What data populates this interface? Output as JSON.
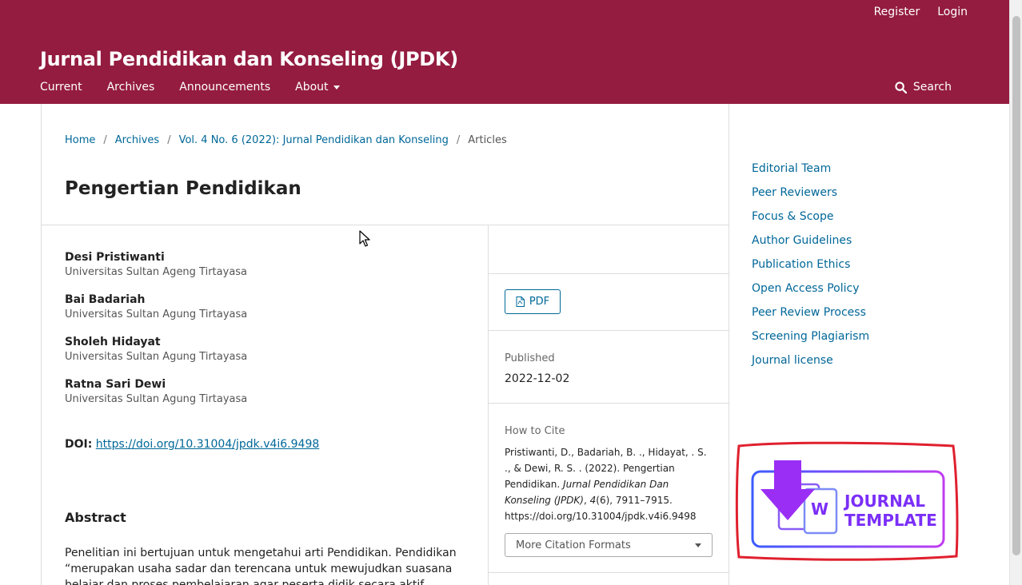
{
  "header": {
    "user_nav": {
      "register": "Register",
      "login": "Login"
    },
    "site_title": "Jurnal Pendidikan dan Konseling (JPDK)",
    "nav": {
      "current": "Current",
      "archives": "Archives",
      "announcements": "Announcements",
      "about": "About"
    },
    "search_label": "Search"
  },
  "breadcrumb": {
    "home": "Home",
    "archives": "Archives",
    "issue": "Vol. 4 No. 6 (2022): Jurnal Pendidikan dan Konseling",
    "current": "Articles",
    "separator": "/"
  },
  "article": {
    "title": "Pengertian Pendidikan",
    "authors": [
      {
        "name": "Desi Pristiwanti",
        "affiliation": "Universitas Sultan Ageng Tirtayasa"
      },
      {
        "name": "Bai Badariah",
        "affiliation": "Universitas Sultan Agung Tirtayasa"
      },
      {
        "name": "Sholeh Hidayat",
        "affiliation": "Universitas Sultan Agung Tirtayasa"
      },
      {
        "name": "Ratna Sari Dewi",
        "affiliation": "Universitas Sultan Agung Tirtayasa"
      }
    ],
    "doi_label": "DOI:",
    "doi_link": "https://doi.org/10.31004/jpdk.v4i6.9498",
    "abstract_heading": "Abstract",
    "abstract_text": "Penelitian ini bertujuan untuk mengetahui arti Pendidikan. Pendidikan “merupakan usaha sadar dan terencana untuk mewujudkan suasana belajar dan proses pembelajaran agar peserta didik secara aktif"
  },
  "details": {
    "pdf_label": "PDF",
    "published_label": "Published",
    "published_date": "2022-12-02",
    "how_to_cite_label": "How to Cite",
    "citation_part1": "Pristiwanti, D., Badariah, B. ., Hidayat, . S. ., & Dewi, R. S. . (2022). Pengertian Pendidikan.",
    "citation_journal": "Jurnal Pendidikan Dan Konseling (JPDK)",
    "citation_sep": ", ",
    "citation_volume": "4",
    "citation_part2": "(6), 7911–7915. https://doi.org/10.31004/jpdk.v4i6.9498",
    "more_formats": "More Citation Formats"
  },
  "sidebar": {
    "items": [
      "Editorial Team",
      "Peer Reviewers",
      "Focus & Scope",
      "Author Guidelines",
      "Publication Ethics",
      "Open Access Policy",
      "Peer Review Process",
      "Screening Plagiarism",
      "Journal license"
    ]
  },
  "banner": {
    "line1": "JOURNAL",
    "line2": "TEMPLATE",
    "badge": "W"
  },
  "colors": {
    "header_bg": "#941c40",
    "link": "#006798",
    "banner_purple": "#7b2ff7",
    "banner_outline": "#e0202e"
  },
  "icons": {
    "search": "search-icon",
    "pdf": "pdf-file-icon",
    "download": "download-arrow-icon",
    "cursor": "mouse-pointer-icon"
  }
}
